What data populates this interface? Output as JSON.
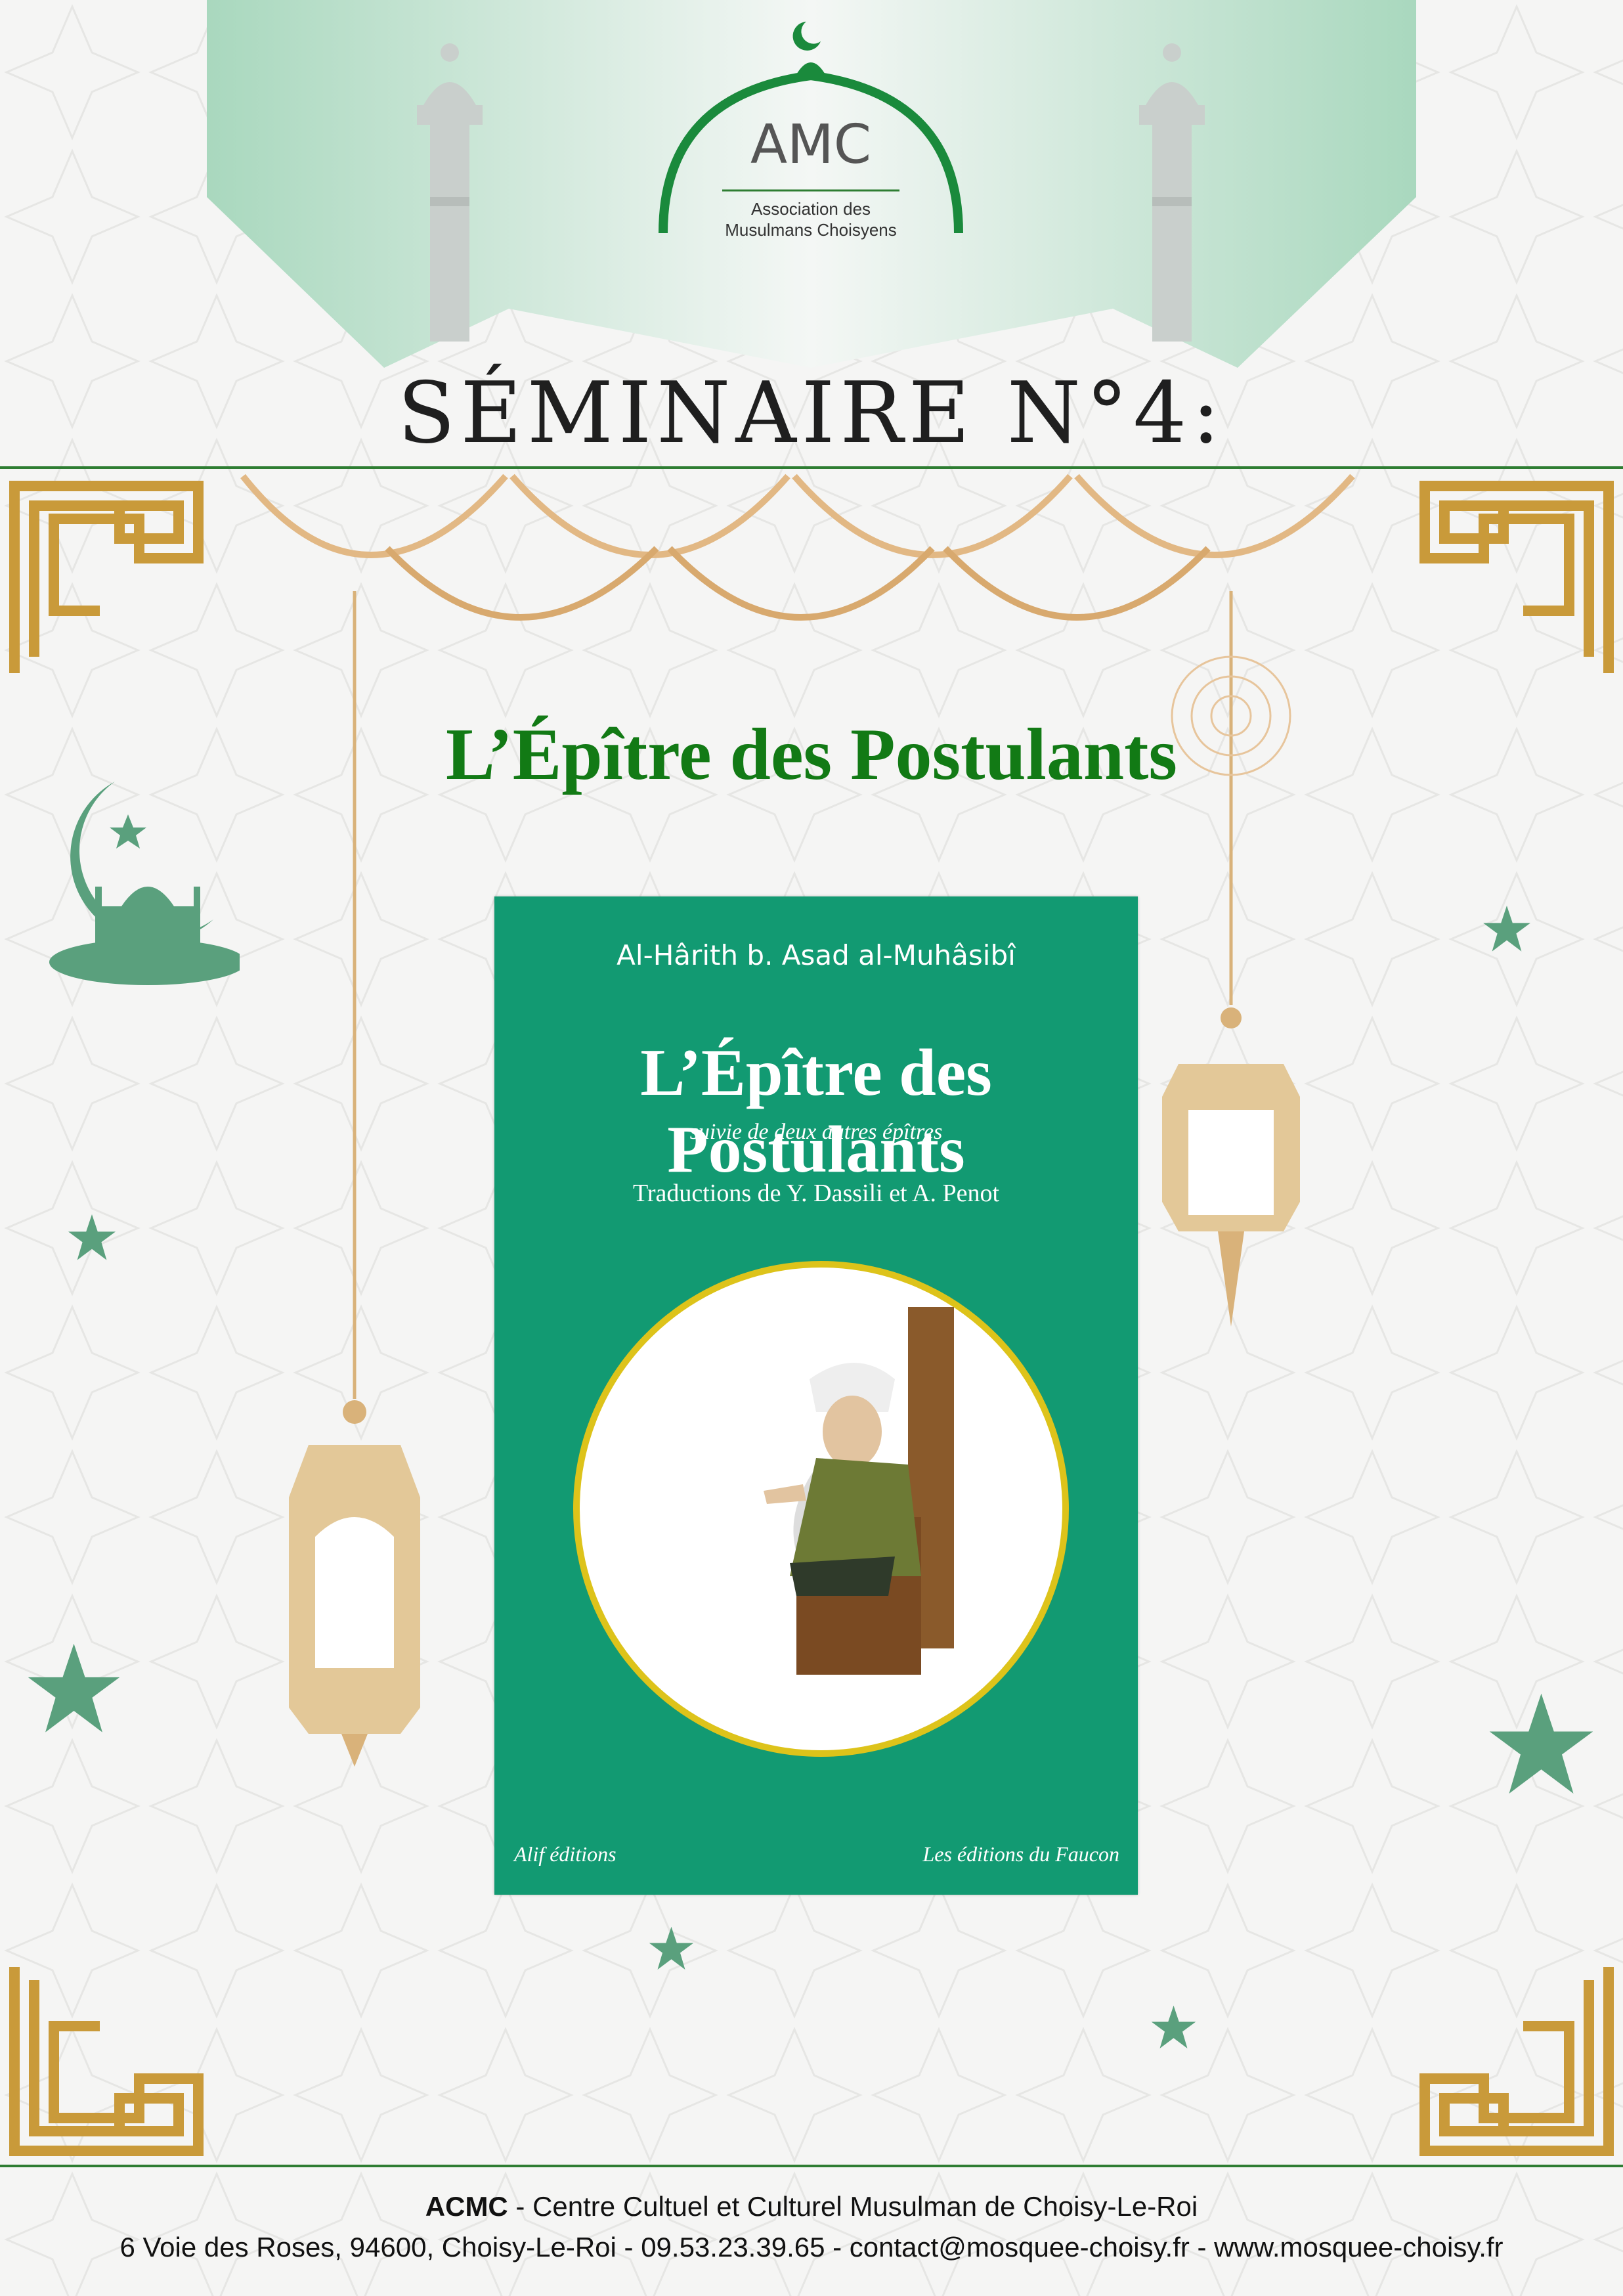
{
  "logo": {
    "acronym": "AMC",
    "name_line1": "Association des",
    "name_line2": "Musulmans Choisyens"
  },
  "header": {
    "title": "SÉMINAIRE N°4:"
  },
  "main": {
    "title": "L’Épître des Postulants"
  },
  "book": {
    "author": "Al-Hârith b. Asad al-Muhâsibî",
    "title": "L’Épître des Postulants",
    "subtitle": "suivie de deux autres épîtres",
    "translators": "Traductions de Y. Dassili et A. Penot",
    "publisher_left": "Alif éditions",
    "publisher_right": "Les éditions du Faucon",
    "cover_color": "#129a72"
  },
  "footer": {
    "org": "ACMC",
    "org_desc": " - Centre Cultuel et Culturel Musulman de Choisy-Le-Roi",
    "contact_line": "6 Voie des Roses, 94600, Choisy-Le-Roi  -  09.53.23.39.65  -  contact@mosquee-choisy.fr  -  www.mosquee-choisy.fr"
  },
  "colors": {
    "accent_green": "#2e7d32",
    "title_green": "#127a15",
    "gold": "#d9b27a"
  }
}
